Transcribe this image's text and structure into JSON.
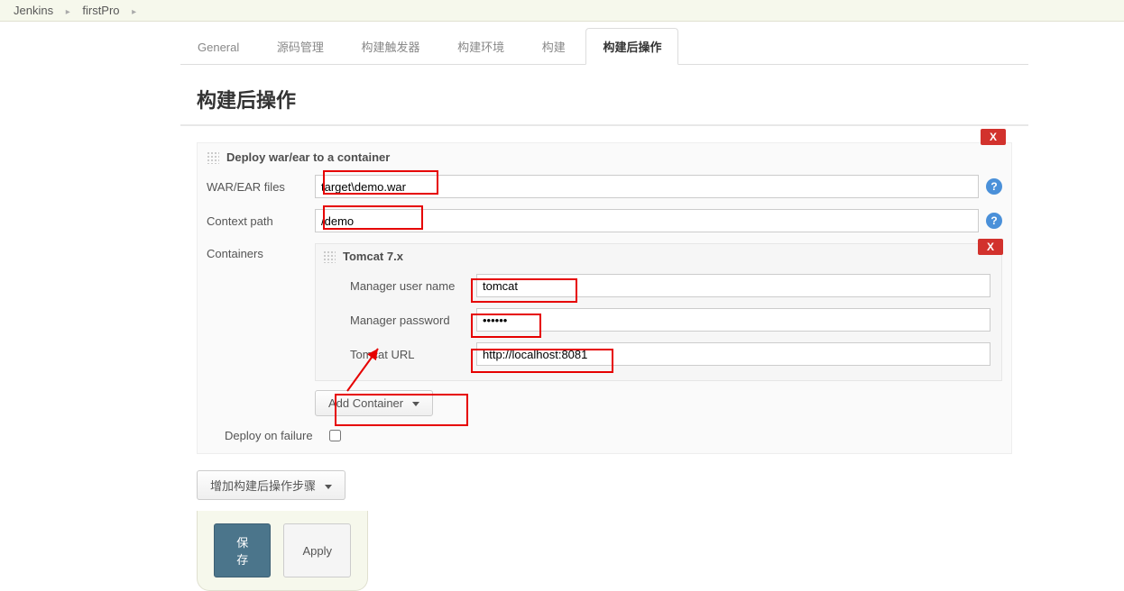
{
  "breadcrumb": {
    "root": "Jenkins",
    "item": "firstPro"
  },
  "tabs": [
    {
      "label": "General",
      "active": false
    },
    {
      "label": "源码管理",
      "active": false
    },
    {
      "label": "构建触发器",
      "active": false
    },
    {
      "label": "构建环境",
      "active": false
    },
    {
      "label": "构建",
      "active": false
    },
    {
      "label": "构建后操作",
      "active": true
    }
  ],
  "section": {
    "title": "构建后操作"
  },
  "deploy": {
    "title": "Deploy war/ear to a container",
    "close": "X",
    "war_label": "WAR/EAR files",
    "war_value": "target\\demo.war",
    "context_label": "Context path",
    "context_value": "/demo",
    "containers_label": "Containers",
    "deploy_on_failure_label": "Deploy on failure",
    "deploy_on_failure_checked": false,
    "container": {
      "title": "Tomcat 7.x",
      "close": "X",
      "user_label": "Manager user name",
      "user_value": "tomcat",
      "pass_label": "Manager password",
      "pass_value": "••••••",
      "url_label": "Tomcat URL",
      "url_value": "http://localhost:8081"
    },
    "add_container_label": "Add Container"
  },
  "add_step": {
    "label": "增加构建后操作步骤"
  },
  "footer": {
    "save": "保存",
    "apply": "Apply"
  },
  "help_glyph": "?"
}
